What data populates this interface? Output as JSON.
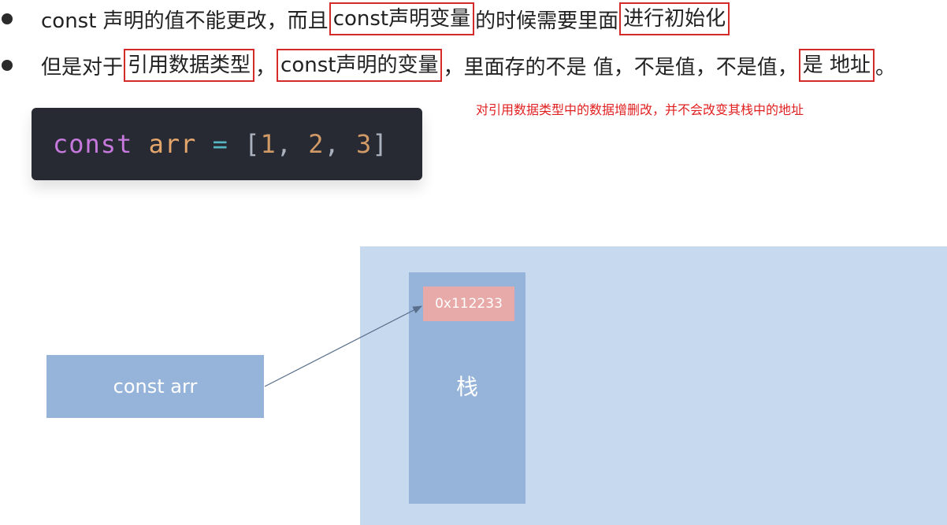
{
  "bullets": [
    {
      "segments": [
        {
          "text": "const  声明的值不能更改，而且",
          "boxed": false
        },
        {
          "text": "const声明变量",
          "boxed": true
        },
        {
          "text": "的时候需要里面",
          "boxed": false
        },
        {
          "text": "进行初始化",
          "boxed": true
        }
      ]
    },
    {
      "segments": [
        {
          "text": "但是对于",
          "boxed": false
        },
        {
          "text": "引用数据类型",
          "boxed": true
        },
        {
          "text": "，",
          "boxed": false
        },
        {
          "text": "const声明的变量",
          "boxed": true
        },
        {
          "text": "，里面存的不是 值，不是值，不是值，",
          "boxed": false
        },
        {
          "text": "是 地址",
          "boxed": true
        },
        {
          "text": "。",
          "boxed": false
        }
      ]
    }
  ],
  "note": "对引用数据类型中的数据增删改，并不会改变其栈中的地址",
  "code": {
    "keyword": "const",
    "name": "arr",
    "operator": "=",
    "open": "[",
    "values": [
      "1",
      "2",
      "3"
    ],
    "close": "]"
  },
  "diagram": {
    "variable_label": "const arr",
    "address": "0x112233",
    "stack_label": "栈"
  },
  "colors": {
    "highlight_border": "#d42a2a",
    "note_text": "#e02020",
    "stack_region": "#c7d9ee",
    "stack_column": "#96b4d9",
    "address_cell": "#e8aaa8"
  }
}
